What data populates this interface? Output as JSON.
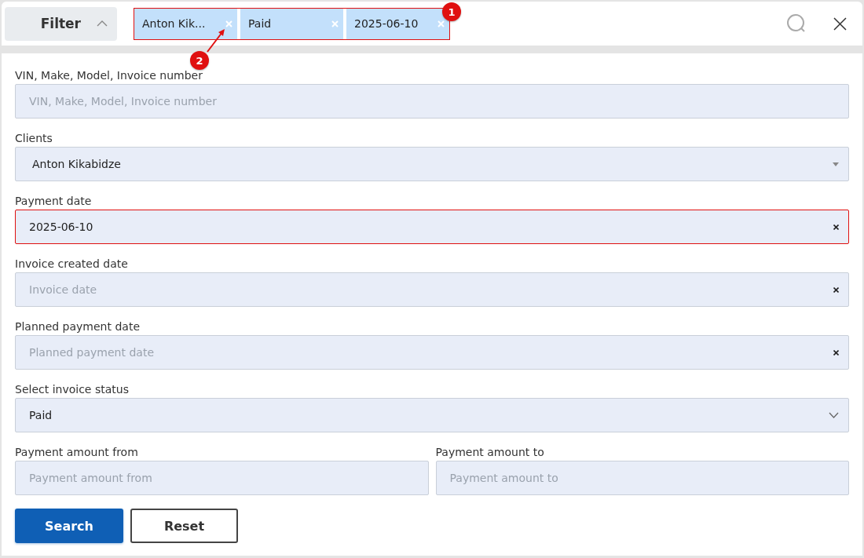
{
  "filter_toggle": {
    "label": "Filter",
    "expanded": true
  },
  "active_filters": {
    "highlighted": true,
    "chips": [
      {
        "label": "Anton Kik..."
      },
      {
        "label": "Paid"
      },
      {
        "label": "2025-06-10"
      }
    ]
  },
  "annotations": [
    {
      "label": "1",
      "kind": "badge"
    },
    {
      "label": "2",
      "kind": "pointer"
    }
  ],
  "form_rows": [
    {
      "fields": [
        {
          "label": "VIN, Make, Model, Invoice number",
          "kind": "text",
          "placeholder": "VIN, Make, Model, Invoice number",
          "highlighted": false
        }
      ]
    },
    {
      "fields": [
        {
          "label": "Clients",
          "kind": "select",
          "value": "Anton Kikabidze",
          "highlighted": false
        }
      ]
    },
    {
      "fields": [
        {
          "label": "Payment date",
          "kind": "date",
          "value": "2025-06-10",
          "highlighted": true
        }
      ]
    },
    {
      "fields": [
        {
          "label": "Invoice created date",
          "kind": "date",
          "placeholder": "Invoice date",
          "highlighted": false
        }
      ]
    },
    {
      "fields": [
        {
          "label": "Planned payment date",
          "kind": "date",
          "placeholder": "Planned payment date",
          "highlighted": false
        }
      ]
    },
    {
      "fields": [
        {
          "label": "Select invoice status",
          "kind": "dropdown",
          "value": "Paid",
          "highlighted": false
        }
      ]
    },
    {
      "fields": [
        {
          "label": "Payment amount from",
          "kind": "text",
          "placeholder": "Payment amount from",
          "highlighted": false
        },
        {
          "label": "Payment amount to",
          "kind": "text",
          "placeholder": "Payment amount to",
          "highlighted": false
        }
      ]
    }
  ],
  "buttons": [
    {
      "label": "Search",
      "kind": "primary"
    },
    {
      "label": "Reset",
      "kind": "secondary"
    }
  ]
}
